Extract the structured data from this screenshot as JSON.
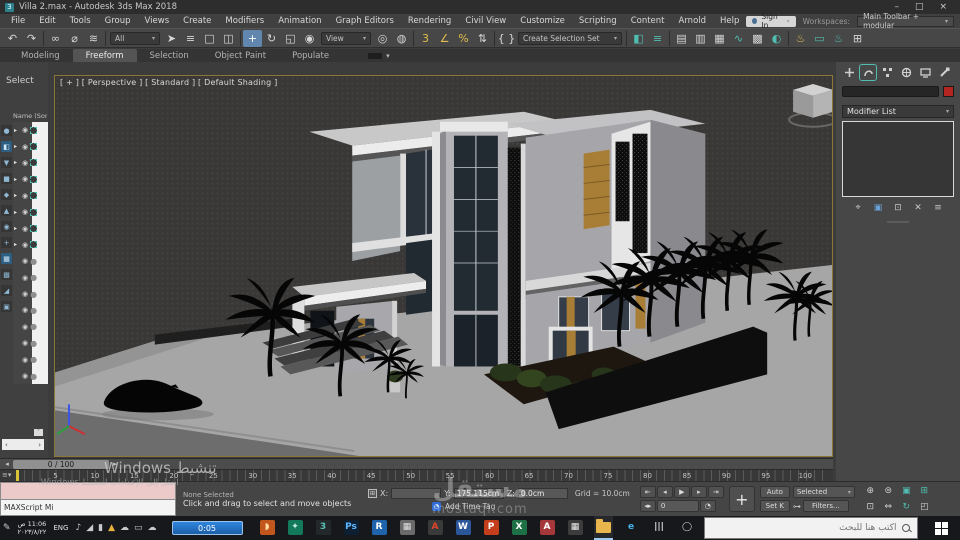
{
  "window": {
    "title": "Villa 2.max - Autodesk 3ds Max 2018",
    "minimize": "–",
    "maximize": "□",
    "close": "×",
    "app_badge": "3"
  },
  "menu_bar": {
    "items": [
      "File",
      "Edit",
      "Tools",
      "Group",
      "Views",
      "Create",
      "Modifiers",
      "Animation",
      "Graph Editors",
      "Rendering",
      "Civil View",
      "Customize",
      "Scripting",
      "Content",
      "Arnold",
      "Help"
    ]
  },
  "session": {
    "sign_in": "Sign In",
    "workspaces_label": "Workspaces:",
    "workspace_value": "Main Toolbar + modular"
  },
  "main_toolbar": {
    "items": [
      {
        "n": "undo-button",
        "g": "↶"
      },
      {
        "n": "redo-button",
        "g": "↷"
      },
      {
        "sep": true
      },
      {
        "n": "select-and-link-button",
        "g": "∞"
      },
      {
        "n": "unlink-selection-button",
        "g": "⌀"
      },
      {
        "n": "bind-to-space-warp-button",
        "g": "≋"
      },
      {
        "sep": true
      },
      {
        "n": "selection-filter-dropdown",
        "drop": true,
        "v": "All",
        "w": 50
      },
      {
        "n": "select-object-button",
        "g": "➤"
      },
      {
        "n": "select-by-name-button",
        "g": "≡"
      },
      {
        "n": "rectangular-selection-region-button",
        "g": "□"
      },
      {
        "n": "window-crossing-button",
        "g": "◫"
      },
      {
        "sep": true
      },
      {
        "n": "select-and-move-button",
        "g": "+",
        "act": true
      },
      {
        "n": "select-and-rotate-button",
        "g": "↻"
      },
      {
        "n": "select-and-scale-button",
        "g": "◱"
      },
      {
        "n": "select-and-place-button",
        "g": "◉"
      },
      {
        "n": "reference-coordinate-system-dropdown",
        "drop": true,
        "v": "View",
        "w": 50
      },
      {
        "n": "use-pivot-point-center-button",
        "g": "◎"
      },
      {
        "n": "select-and-manipulate-button",
        "g": "◍"
      },
      {
        "sep": true
      },
      {
        "n": "snaps-toggle-button",
        "g": "3",
        "c": "y"
      },
      {
        "n": "angle-snap-toggle-button",
        "g": "∠",
        "c": "y"
      },
      {
        "n": "percent-snap-toggle-button",
        "g": "%",
        "c": "y"
      },
      {
        "n": "spinner-snap-toggle-button",
        "g": "⇅"
      },
      {
        "sep": true
      },
      {
        "n": "edit-named-selection-sets-button",
        "g": "{ }"
      },
      {
        "n": "named-selection-sets-dropdown",
        "drop": true,
        "v": "Create Selection Set",
        "w": 104
      },
      {
        "sep": true
      },
      {
        "n": "mirror-button",
        "g": "◧",
        "c": "t"
      },
      {
        "n": "align-button",
        "g": "≡",
        "c": "t"
      },
      {
        "sep": true
      },
      {
        "n": "toggle-scene-explorer-button",
        "g": "▤"
      },
      {
        "n": "toggle-layer-explorer-button",
        "g": "▥"
      },
      {
        "n": "toggle-ribbon-button",
        "g": "▦"
      },
      {
        "n": "curve-editor-button",
        "g": "∿",
        "c": "t"
      },
      {
        "n": "schematic-view-button",
        "g": "▩"
      },
      {
        "n": "material-editor-button",
        "g": "◐",
        "c": "t"
      },
      {
        "sep": true
      },
      {
        "n": "render-setup-button",
        "g": "♨",
        "c": "y"
      },
      {
        "n": "rendered-frame-window-button",
        "g": "▭",
        "c": "t"
      },
      {
        "n": "render-production-button",
        "g": "♨",
        "c": "t"
      },
      {
        "n": "render-presets-button",
        "g": "⊞"
      }
    ]
  },
  "ribbon": {
    "tabs": [
      {
        "label": "Modeling"
      },
      {
        "label": "Freeform",
        "active": true
      },
      {
        "label": "Selection"
      },
      {
        "label": "Object Paint"
      },
      {
        "label": "Populate"
      }
    ]
  },
  "scene_explorer": {
    "header": "Select",
    "column_header": "Name (Sor",
    "side_icons": [
      "●",
      "◧",
      "▼",
      "■",
      "◆",
      "▲",
      "◉",
      "+",
      "▦",
      "▩",
      "◢",
      "▣"
    ],
    "rows": [
      {
        "t": "g"
      },
      {
        "t": "g"
      },
      {
        "t": "g"
      },
      {
        "t": "g"
      },
      {
        "t": "g"
      },
      {
        "t": "g"
      },
      {
        "t": "g"
      },
      {
        "t": "g"
      },
      {
        "t": "s"
      },
      {
        "t": "s"
      },
      {
        "t": "s"
      },
      {
        "t": "s"
      },
      {
        "t": "s"
      },
      {
        "t": "s"
      },
      {
        "t": "s"
      },
      {
        "t": "s"
      }
    ],
    "scroll_left": "‹",
    "scroll_right": "›",
    "scroll_down": "˅"
  },
  "viewport": {
    "label": "[ + ] [ Perspective ] [ Standard ] [ Default Shading ]"
  },
  "command_panel": {
    "modifier_list": "Modifier List"
  },
  "time_slider": {
    "frame_indicator": "0 / 100"
  },
  "track_bar": {
    "ticks": [
      5,
      10,
      15,
      20,
      25,
      30,
      35,
      40,
      45,
      50,
      55,
      60,
      65,
      70,
      75,
      80,
      85,
      90,
      95,
      100
    ]
  },
  "status_bar": {
    "listener_line": "MAXScript Mi",
    "selection_status": "None Selected",
    "prompt": "Click and drag to select and move objects",
    "x_label": "X:",
    "x_value": "",
    "y_label": "Y:",
    "y_value": "175.115cm",
    "z_label": "Z:",
    "z_value": "0.0cm",
    "grid_label": "Grid = 10.0cm",
    "time_tag": "Add Time Tag",
    "auto_key": "Auto",
    "set_key": "Set K",
    "key_scope": "Selected",
    "key_filters": "Filters...",
    "frame_value": "0"
  },
  "overlays": {
    "activation_line1": "تنشيط Windows",
    "activation_line2": "انتقل إلى الإعدادات لتنشيط Windows.",
    "watermark_title": "مستقل",
    "watermark_domain": "mostaql.com",
    "recorder_time": "0:05"
  },
  "taskbar": {
    "time": "11:06 ص",
    "date": "٢٠٢٣/٨/٢٢",
    "language": "ENG",
    "search_placeholder": "اكتب هنا للبحث",
    "tray": [
      {
        "name": "volume-icon",
        "glyph": "♪"
      },
      {
        "name": "network-icon",
        "glyph": "◢"
      },
      {
        "name": "battery-icon",
        "glyph": "▮"
      },
      {
        "name": "drive-icon",
        "glyph": "▲",
        "fg": "#e8b33c"
      },
      {
        "name": "onedrive-icon",
        "glyph": "☁"
      },
      {
        "name": "monitor-icon",
        "glyph": "▭"
      },
      {
        "name": "cloud-icon",
        "glyph": "☁"
      }
    ],
    "apps": [
      {
        "name": "media-app",
        "label": "◗",
        "bg": "#c2571d",
        "fg": "#ffd9a0"
      },
      {
        "name": "green-app",
        "label": "✦",
        "bg": "#13795b",
        "fg": "#bfead9"
      },
      {
        "name": "3ds-max-app",
        "label": "3",
        "bg": "#23292b",
        "fg": "#57c2b4"
      },
      {
        "name": "photoshop-app",
        "label": "Ps",
        "bg": "#0c1f33",
        "fg": "#5fb7ff"
      },
      {
        "name": "revit-app",
        "label": "R",
        "bg": "#1f63ad",
        "fg": "#ffffff"
      },
      {
        "name": "collage-app",
        "label": "▦",
        "bg": "#6a6a6a",
        "fg": "#e0e0e0"
      },
      {
        "name": "autocad-app",
        "label": "A",
        "bg": "#3a3a3a",
        "fg": "#e0462c"
      },
      {
        "name": "word-app",
        "label": "W",
        "bg": "#2b579a",
        "fg": "#ffffff"
      },
      {
        "name": "powerpoint-app",
        "label": "P",
        "bg": "#c43e1c",
        "fg": "#ffffff"
      },
      {
        "name": "excel-app",
        "label": "X",
        "bg": "#1e7145",
        "fg": "#ffffff"
      },
      {
        "name": "access-app",
        "label": "A",
        "bg": "#a4373a",
        "fg": "#ffffff"
      },
      {
        "name": "calculator-app",
        "label": "▦",
        "bg": "#3c3c3c",
        "fg": "#efefef"
      },
      {
        "name": "file-explorer-app",
        "shape": "folder",
        "active": true
      },
      {
        "name": "edge-app",
        "label": "e",
        "flat": true,
        "fg": "#45b5e8"
      },
      {
        "name": "task-view-app",
        "label": "|||",
        "flat": true,
        "fg": "#dddddd"
      },
      {
        "name": "cortana-app",
        "label": "◯",
        "flat": true,
        "fg": "#cccccc"
      }
    ]
  },
  "colors": {
    "accent_teal": "#4fbdb0",
    "accent_yellow": "#e3bd4e",
    "active_tool": "#6187ae",
    "viewport_border": "#8a7734"
  }
}
